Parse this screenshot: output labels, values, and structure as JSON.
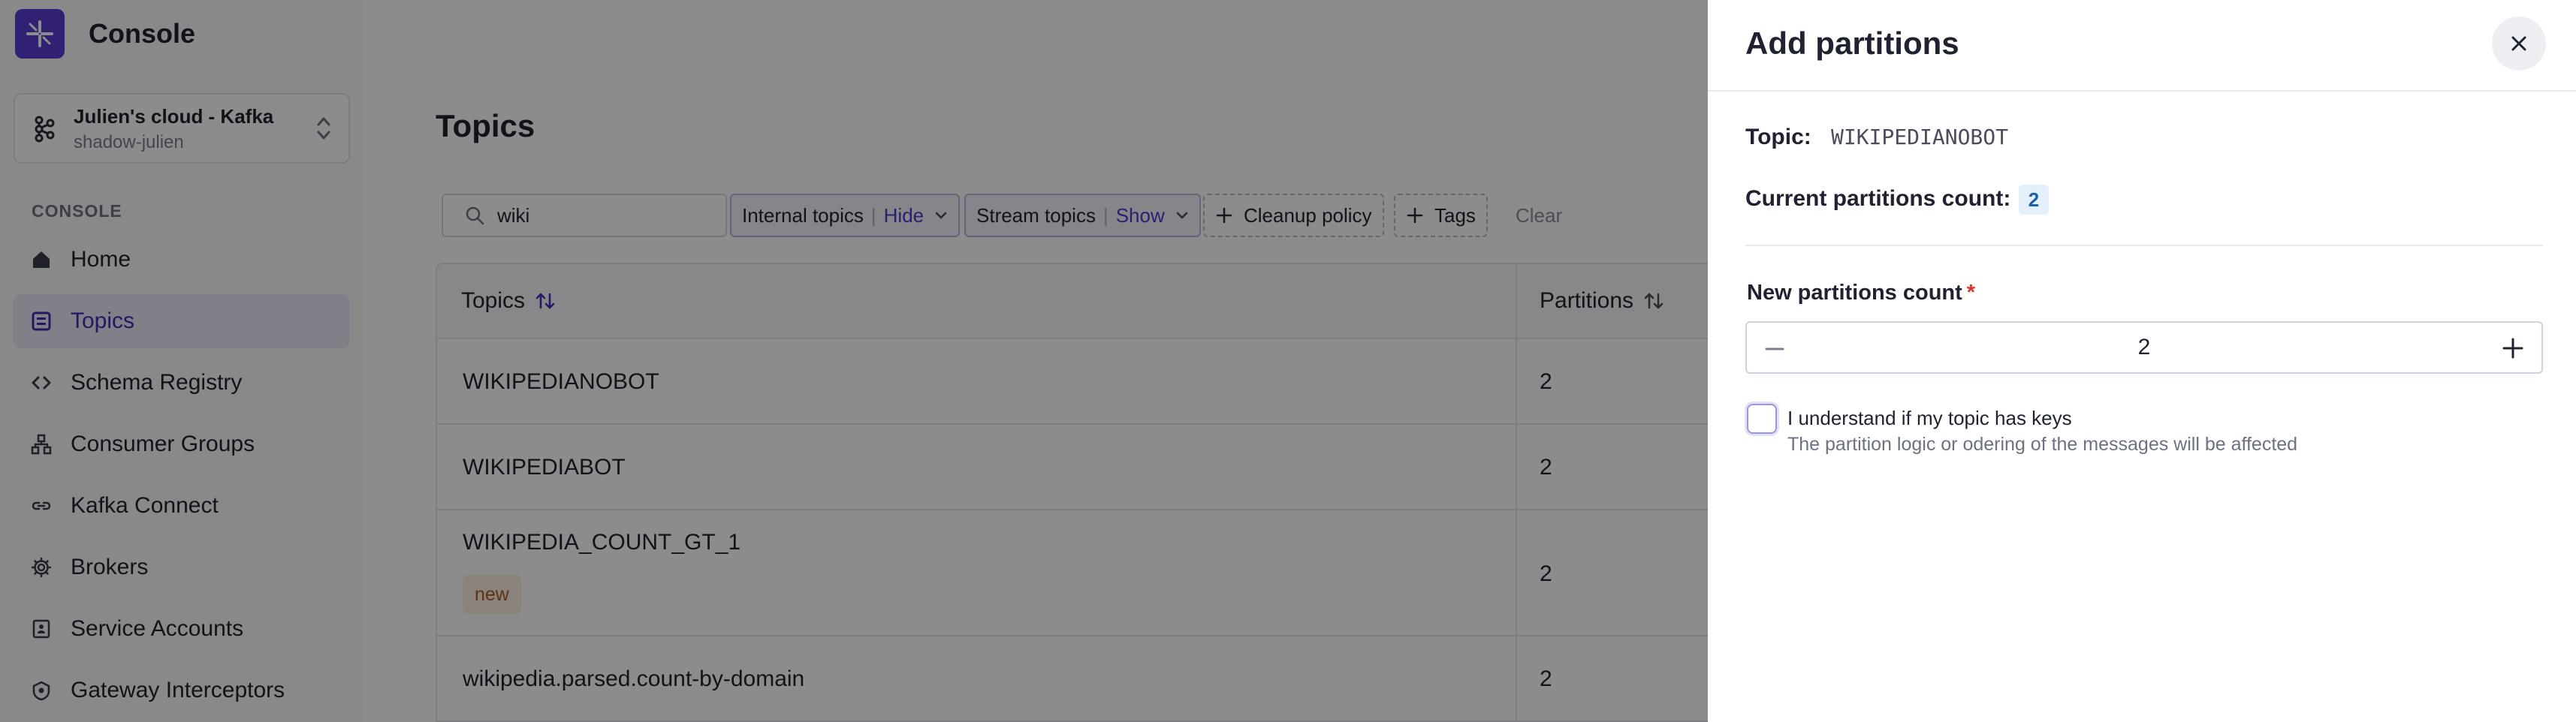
{
  "app": {
    "name": "Console"
  },
  "cluster": {
    "name": "Julien's cloud - Kafka",
    "sub": "shadow-julien"
  },
  "sidebar": {
    "section": "CONSOLE",
    "items": [
      {
        "label": "Home",
        "icon": "home-icon"
      },
      {
        "label": "Topics",
        "icon": "topics-icon",
        "active": true
      },
      {
        "label": "Schema Registry",
        "icon": "code-icon"
      },
      {
        "label": "Consumer Groups",
        "icon": "consumer-groups-icon"
      },
      {
        "label": "Kafka Connect",
        "icon": "connect-icon"
      },
      {
        "label": "Brokers",
        "icon": "gear-icon"
      },
      {
        "label": "Service Accounts",
        "icon": "service-accounts-icon"
      },
      {
        "label": "Gateway Interceptors",
        "icon": "gateway-icon"
      }
    ]
  },
  "main": {
    "title": "Topics",
    "search": {
      "value": "wiki"
    },
    "filters": {
      "internal": {
        "label": "Internal topics",
        "value": "Hide"
      },
      "stream": {
        "label": "Stream topics",
        "value": "Show"
      },
      "cleanup": "Cleanup policy",
      "tags": "Tags",
      "clear": "Clear"
    },
    "table": {
      "columns": [
        "Topics",
        "Partitions"
      ],
      "rows": [
        {
          "name": "WIKIPEDIANOBOT",
          "partitions": "2"
        },
        {
          "name": "WIKIPEDIABOT",
          "partitions": "2"
        },
        {
          "name": "WIKIPEDIA_COUNT_GT_1",
          "partitions": "2",
          "badge": "new"
        },
        {
          "name": "wikipedia.parsed.count-by-domain",
          "partitions": "2"
        }
      ]
    }
  },
  "drawer": {
    "title": "Add partitions",
    "topic_label": "Topic:",
    "topic_value": "WIKIPEDIANOBOT",
    "current_label": "Current partitions count:",
    "current_value": "2",
    "new_label": "New partitions count",
    "required_mark": "*",
    "new_value": "2",
    "checkbox_label": "I understand if my topic has keys",
    "checkbox_help": "The partition logic or odering of the messages will be affected"
  },
  "colors": {
    "brand": "#5b3bd6",
    "accent": "#4a3cc8",
    "overlay": "rgba(0,0,0,0.45)"
  }
}
